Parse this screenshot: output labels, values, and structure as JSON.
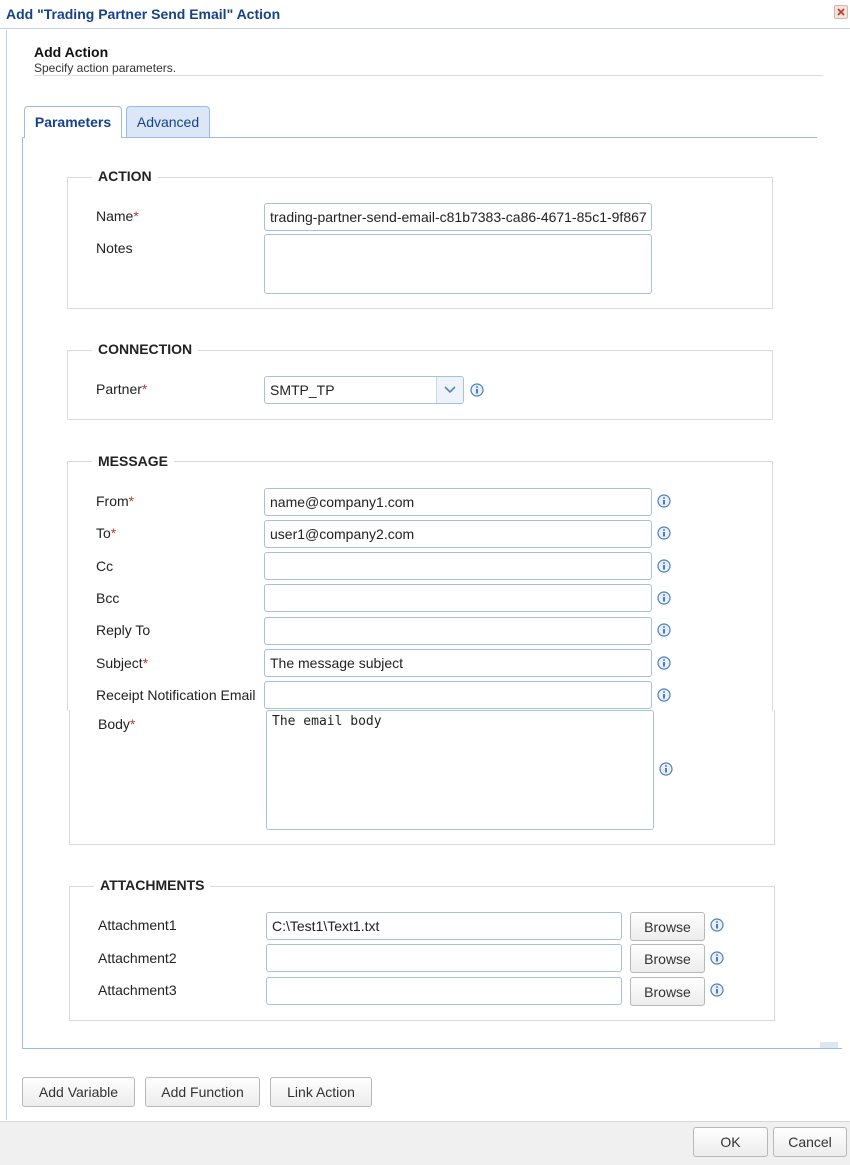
{
  "window": {
    "title": "Add \"Trading Partner Send Email\" Action"
  },
  "header": {
    "title": "Add Action",
    "subtitle": "Specify action parameters."
  },
  "tabs": [
    {
      "label": "Parameters",
      "active": true
    },
    {
      "label": "Advanced",
      "active": false
    }
  ],
  "action": {
    "legend": "ACTION",
    "name_label": "Name",
    "name_value": "trading-partner-send-email-c81b7383-ca86-4671-85c1-9f867",
    "notes_label": "Notes",
    "notes_value": ""
  },
  "connection": {
    "legend": "CONNECTION",
    "partner_label": "Partner",
    "partner_value": "SMTP_TP"
  },
  "message": {
    "legend": "MESSAGE",
    "from_label": "From",
    "from_value": "name@company1.com",
    "to_label": "To",
    "to_value": "user1@company2.com",
    "cc_label": "Cc",
    "cc_value": "",
    "bcc_label": "Bcc",
    "bcc_value": "",
    "reply_to_label": "Reply To",
    "reply_to_value": "",
    "subject_label": "Subject",
    "subject_value": "The message subject",
    "receipt_label": "Receipt Notification Email",
    "receipt_value": "",
    "body_label": "Body",
    "body_value": "The email body"
  },
  "attachments": {
    "legend": "ATTACHMENTS",
    "items": [
      {
        "label": "Attachment1",
        "value": "C:\\Test1\\Text1.txt",
        "browse": "Browse"
      },
      {
        "label": "Attachment2",
        "value": "",
        "browse": "Browse"
      },
      {
        "label": "Attachment3",
        "value": "",
        "browse": "Browse"
      }
    ]
  },
  "required_marker": "*",
  "buttons": {
    "add_variable": "Add Variable",
    "add_function": "Add Function",
    "link_action": "Link Action",
    "ok": "OK",
    "cancel": "Cancel"
  },
  "colors": {
    "accent": "#15428b",
    "required": "#c0392b",
    "border": "#99bbe8",
    "info_icon": "#4a7fc1"
  },
  "icons": {
    "info": "info-icon",
    "close": "close-icon",
    "dropdown": "chevron-down-icon"
  }
}
